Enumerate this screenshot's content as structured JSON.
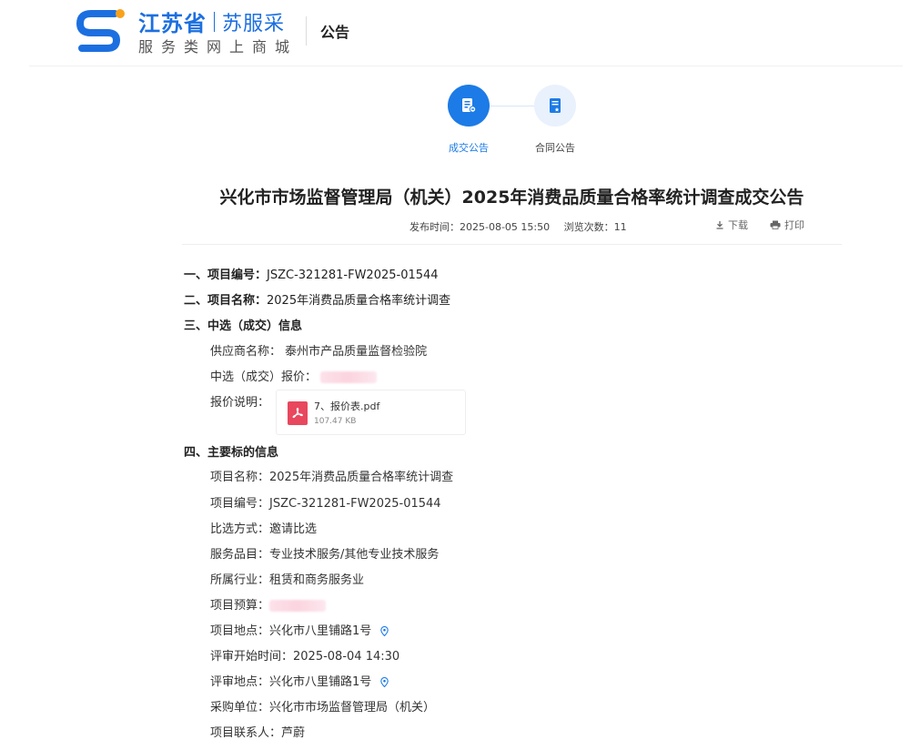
{
  "header": {
    "brand_province": "江苏省",
    "brand_name": "苏服采",
    "brand_subtitle": "服务类网上商城",
    "page_title": "公告"
  },
  "steps": [
    {
      "label": "成交公告",
      "active": true,
      "icon": "deal-doc-icon"
    },
    {
      "label": "合同公告",
      "active": false,
      "icon": "contract-doc-icon"
    }
  ],
  "notice": {
    "title": "兴化市市场监督管理局（机关）2025年消费品质量合格率统计调查成交公告",
    "publish_time": "发布时间：2025-08-05 15:50",
    "view_count": "浏览次数：11",
    "download_label": "下载",
    "print_label": "打印"
  },
  "sections": {
    "s1": {
      "label": "一、项目编号：",
      "value": "JSZC-321281-FW2025-01544"
    },
    "s2": {
      "label": "二、项目名称：",
      "value": "2025年消费品质量合格率统计调查"
    },
    "s3": {
      "label": "三、中选（成交）信息"
    },
    "s4": {
      "label": "四、主要标的信息"
    }
  },
  "winner": {
    "supplier_label": "供应商名称：",
    "supplier_value": "泰州市产品质量监督检验院",
    "price_label": "中选（成交）报价：",
    "price_note_label": "报价说明："
  },
  "attachment": {
    "name": "7、报价表.pdf",
    "size": "107.47 KB",
    "icon": "pdf-file-icon"
  },
  "details": [
    {
      "label": "项目名称：",
      "value": "2025年消费品质量合格率统计调查"
    },
    {
      "label": "项目编号：",
      "value": "JSZC-321281-FW2025-01544"
    },
    {
      "label": "比选方式：",
      "value": "邀请比选"
    },
    {
      "label": "服务品目：",
      "value": "专业技术服务/其他专业技术服务"
    },
    {
      "label": "所属行业：",
      "value": "租赁和商务服务业"
    },
    {
      "label": "项目预算：",
      "value": ""
    },
    {
      "label": "项目地点：",
      "value": "兴化市八里铺路1号"
    },
    {
      "label": "评审开始时间：",
      "value": "2025-08-04 14:30"
    },
    {
      "label": "评审地点：",
      "value": "兴化市八里铺路1号"
    },
    {
      "label": "采购单位：",
      "value": "兴化市市场监督管理局（机关）"
    },
    {
      "label": "项目联系人：",
      "value": "芦蔚"
    }
  ],
  "colors": {
    "accent": "#1c7be6",
    "pdf": "#e8475e"
  }
}
